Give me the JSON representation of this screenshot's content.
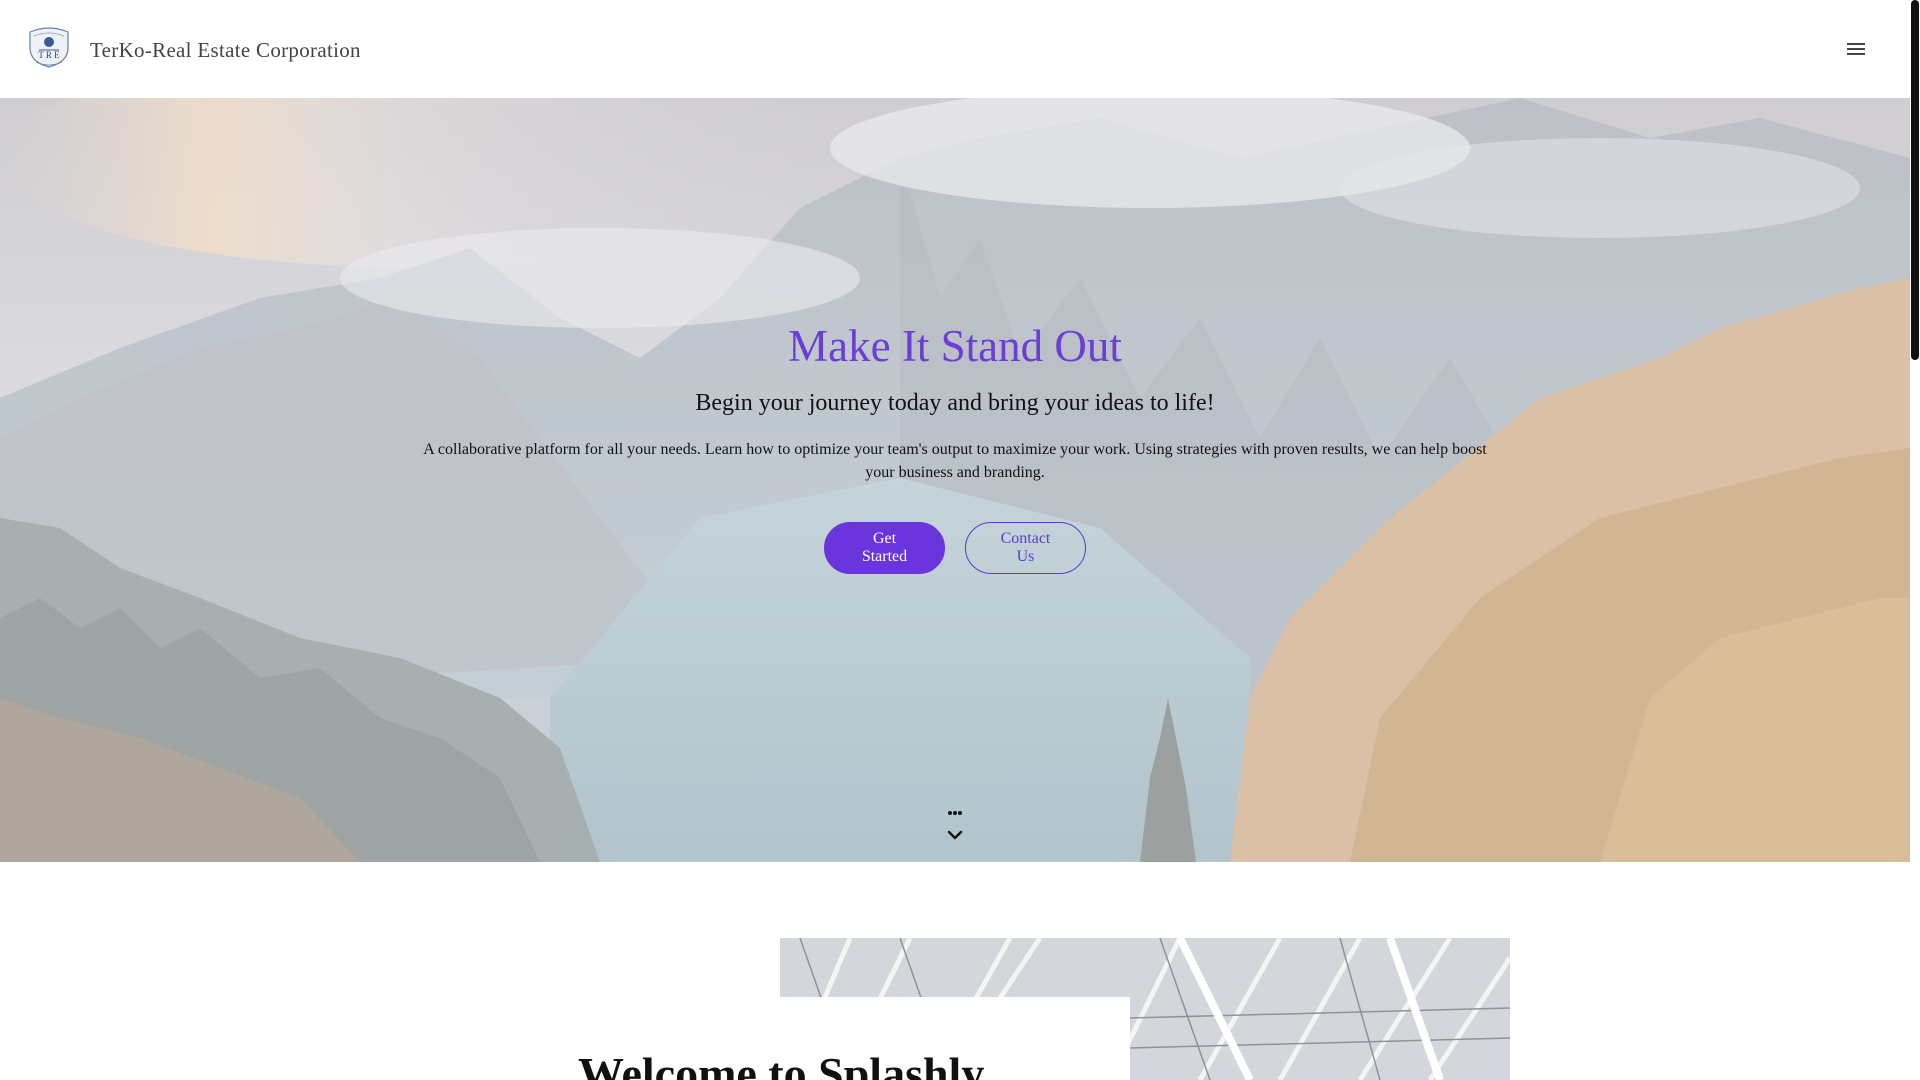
{
  "header": {
    "brand": "TerKo-Real Estate Corporation",
    "logo_icon": "tre-crest-logo",
    "menu_icon": "hamburger-menu-icon"
  },
  "hero": {
    "title": "Make It Stand Out",
    "subtitle": "Begin your journey today and bring your ideas to life!",
    "description": "A collaborative platform for all your needs. Learn how to optimize your team's output to maximize your work. Using strategies with proven results, we can help boost your business and branding.",
    "primary_button": "Get Started",
    "secondary_button": "Contact Us",
    "scroll_icon": "chevron-down-icon"
  },
  "section2": {
    "heading": "Welcome to Splashly"
  },
  "colors": {
    "accent": "#6a35dc",
    "title": "#6b3fd6"
  }
}
